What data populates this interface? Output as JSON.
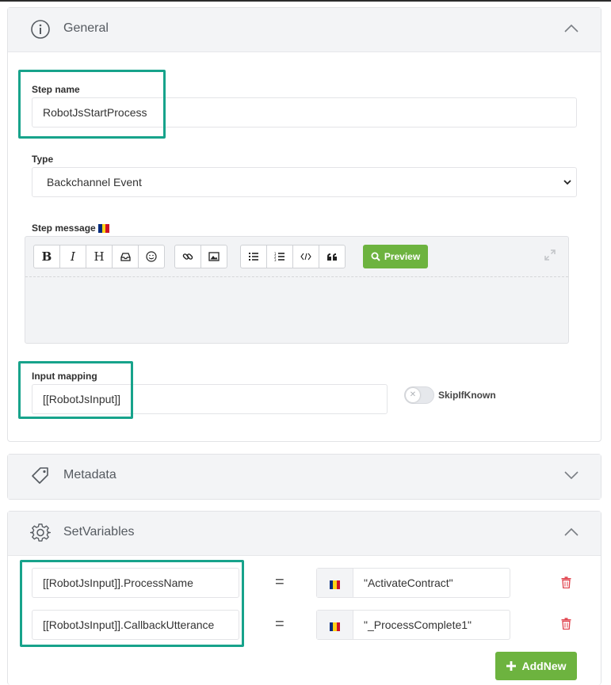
{
  "general": {
    "title": "General",
    "step_name_label": "Step name",
    "step_name_value": "RobotJsStartProcess",
    "type_label": "Type",
    "type_value": "Backchannel Event",
    "step_message_label": "Step message",
    "input_mapping_label": "Input mapping",
    "input_mapping_value": "[[RobotJsInput]]",
    "skip_if_known_label": "SkipIfKnown",
    "skip_if_known_on": false
  },
  "editor": {
    "toolbar": [
      "B",
      "I",
      "H",
      "inbox-icon",
      "smiley-icon",
      "link-icon",
      "image-icon",
      "bullet-list-icon",
      "numbered-list-icon",
      "code-icon",
      "quote-icon"
    ],
    "preview_label": "Preview"
  },
  "metadata": {
    "title": "Metadata"
  },
  "set_variables": {
    "title": "SetVariables",
    "rows": [
      {
        "key": "[[RobotJsInput]].ProcessName",
        "op": "=",
        "value": "\"ActivateContract\""
      },
      {
        "key": "[[RobotJsInput]].CallbackUtterance",
        "op": "=",
        "value": "\"_ProcessComplete1\""
      }
    ],
    "add_new_label": "AddNew"
  },
  "colors": {
    "highlight": "#17a38b",
    "accent_green": "#6db33f",
    "delete_red": "#e0404b"
  }
}
